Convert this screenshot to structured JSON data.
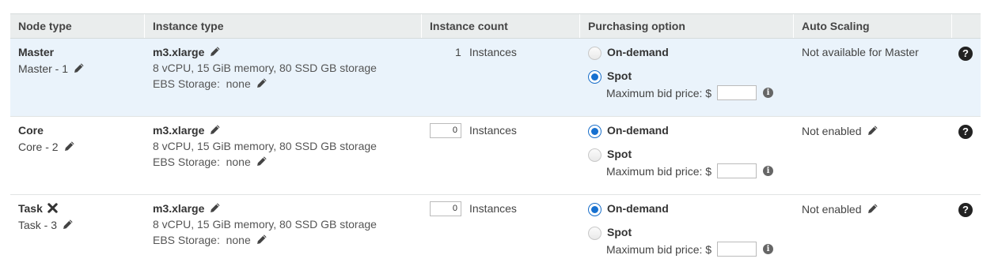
{
  "columns": {
    "node_type": "Node type",
    "instance_type": "Instance type",
    "instance_count": "Instance count",
    "purchasing_option": "Purchasing option",
    "auto_scaling": "Auto Scaling"
  },
  "rows": [
    {
      "node_type": "Master",
      "node_name": "Master - 1",
      "instance_type": "m3.xlarge",
      "specs": "8 vCPU, 15 GiB memory, 80 SSD GB storage",
      "ebs_label": "EBS Storage:",
      "ebs_value": "none",
      "count": "1",
      "count_editable": false,
      "instances_label": "Instances",
      "purchase_selected": "Spot",
      "on_demand_label": "On-demand",
      "spot_label": "Spot",
      "bid_label": "Maximum bid price: $",
      "bid_value": "",
      "auto_scaling": "Not available for Master",
      "auto_scaling_editable": false,
      "selected": true
    },
    {
      "node_type": "Core",
      "node_name": "Core - 2",
      "instance_type": "m3.xlarge",
      "specs": "8 vCPU, 15 GiB memory, 80 SSD GB storage",
      "ebs_label": "EBS Storage:",
      "ebs_value": "none",
      "count": "0",
      "count_editable": true,
      "instances_label": "Instances",
      "purchase_selected": "On-demand",
      "on_demand_label": "On-demand",
      "spot_label": "Spot",
      "bid_label": "Maximum bid price: $",
      "bid_value": "",
      "auto_scaling": "Not enabled",
      "auto_scaling_editable": true,
      "selected": false
    },
    {
      "node_type": "Task",
      "node_name": "Task - 3",
      "instance_type": "m3.xlarge",
      "specs": "8 vCPU, 15 GiB memory, 80 SSD GB storage",
      "ebs_label": "EBS Storage:",
      "ebs_value": "none",
      "count": "0",
      "count_editable": true,
      "instances_label": "Instances",
      "purchase_selected": "On-demand",
      "on_demand_label": "On-demand",
      "spot_label": "Spot",
      "bid_label": "Maximum bid price: $",
      "bid_value": "",
      "auto_scaling": "Not enabled",
      "auto_scaling_editable": true,
      "selected": false
    }
  ],
  "colors": {
    "header_bg": "#eaeded",
    "selected_row_bg": "#eaf3fb",
    "radio_selected": "#1670d0"
  },
  "icons": {
    "edit": "pencil-icon",
    "remove": "close-x-icon",
    "info": "info-icon",
    "help": "help-icon"
  }
}
